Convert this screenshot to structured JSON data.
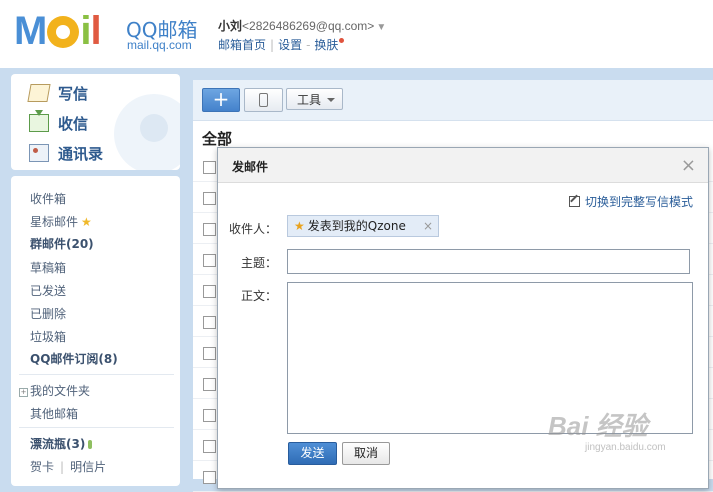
{
  "header": {
    "logo_text": "MOil",
    "brand": "QQ邮箱",
    "url": "mail.qq.com",
    "user_name": "小刘",
    "user_email": "<2826486269@qq.com>",
    "links": [
      "邮箱首页",
      "设置",
      "换肤"
    ],
    "accent_color": "#3f81c8"
  },
  "sidebar": {
    "actions": [
      {
        "label": "写信",
        "icon": "write-icon"
      },
      {
        "label": "收信",
        "icon": "inbox-icon"
      },
      {
        "label": "通讯录",
        "icon": "contacts-icon"
      }
    ],
    "folders": [
      "收件箱",
      "星标邮件",
      "群邮件(20)",
      "草稿箱",
      "已发送",
      "已删除",
      "垃圾箱",
      "QQ邮件订阅(8)"
    ],
    "my_folders": "我的文件夹",
    "other_mail": "其他邮箱",
    "drift_bottle": "漂流瓶(3)",
    "greeting_card": "贺卡",
    "postcard": "明信片"
  },
  "toolbar": {
    "new_button": "+",
    "tools_label": "工具"
  },
  "list": {
    "title": "全部",
    "row_count": 11
  },
  "dialog": {
    "title": "发邮件",
    "close": "×",
    "switch_mode": "切换到完整写信模式",
    "to_label": "收件人：",
    "recipient": "发表到我的Qzone",
    "recipient_remove": "×",
    "subject_label": "主题：",
    "body_label": "正文：",
    "send": "发送",
    "cancel": "取消"
  },
  "watermark": {
    "text": "Bai 经验",
    "url": "jingyan.baidu.com"
  }
}
